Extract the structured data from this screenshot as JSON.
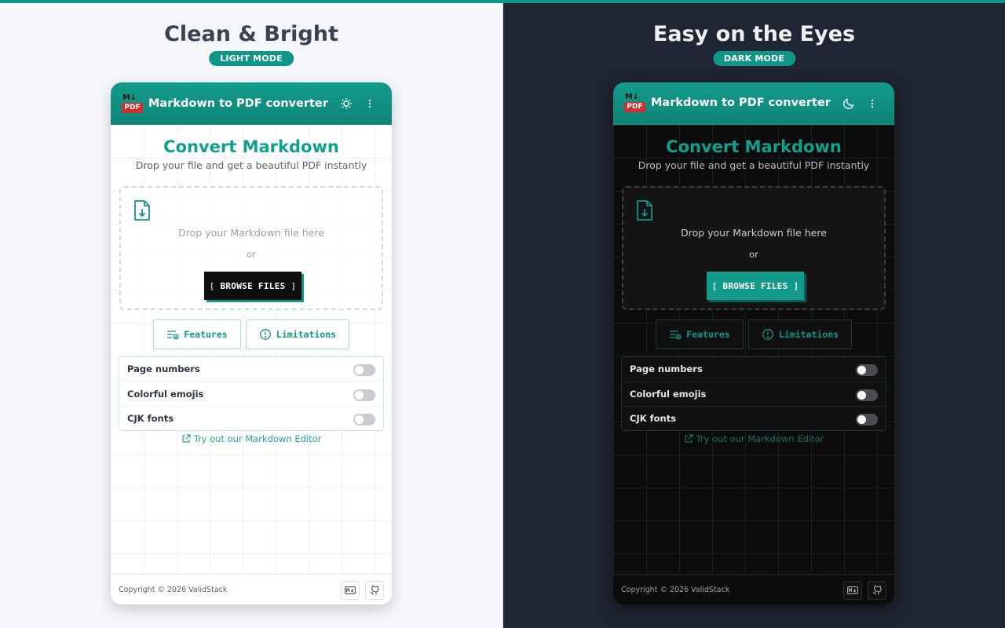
{
  "colors": {
    "accent": "#0f9688",
    "pdf_red": "#d32f2f"
  },
  "panels": [
    {
      "headline": "Clean & Bright",
      "badge": "LIGHT MODE",
      "app_title": "Markdown to PDF converter",
      "logo_top": "M↓",
      "logo_bottom": "PDF",
      "theme_icon": "sun-icon",
      "convert_title": "Convert Markdown",
      "convert_subtitle": "Drop your file and get a beautiful PDF instantly",
      "drop_text": "Drop your Markdown file here",
      "or_text": "or",
      "browse_label": "BROWSE FILES",
      "tab_features": "Features",
      "tab_limitations": "Limitations",
      "settings": [
        {
          "label": "Page numbers",
          "enabled": false
        },
        {
          "label": "Colorful emojis",
          "enabled": false
        },
        {
          "label": "CJK fonts",
          "enabled": false
        }
      ],
      "editor_link": "Try out our Markdown Editor",
      "copyright": "Copyright © 2026 ValidStack"
    },
    {
      "headline": "Easy on the Eyes",
      "badge": "DARK MODE",
      "app_title": "Markdown to PDF converter",
      "logo_top": "M↓",
      "logo_bottom": "PDF",
      "theme_icon": "moon-icon",
      "convert_title": "Convert Markdown",
      "convert_subtitle": "Drop your file and get a beautiful PDF instantly",
      "drop_text": "Drop your Markdown file here",
      "or_text": "or",
      "browse_label": "BROWSE FILES",
      "tab_features": "Features",
      "tab_limitations": "Limitations",
      "settings": [
        {
          "label": "Page numbers",
          "enabled": false
        },
        {
          "label": "Colorful emojis",
          "enabled": false
        },
        {
          "label": "CJK fonts",
          "enabled": false
        }
      ],
      "editor_link": "Try out our Markdown Editor",
      "copyright": "Copyright © 2026 ValidStack"
    }
  ]
}
